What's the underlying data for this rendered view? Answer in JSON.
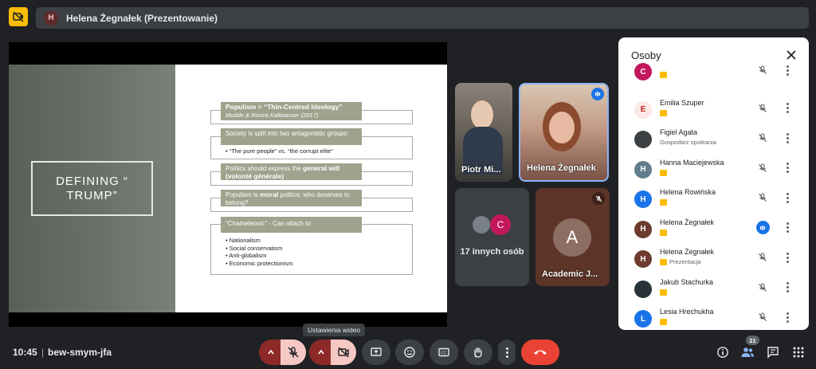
{
  "top_bar": {
    "avatar_letter": "H",
    "title": "Helena Żegnałek (Prezentowanie)"
  },
  "slide": {
    "title": "DEFINING “\nTRUMP”",
    "boxes": [
      {
        "heading": "Populism = “Thin-Centred Ideology”",
        "sub": "Mudde & Rovira Kaltwasser (2017)"
      },
      {
        "heading": "Society is split into two antagonistic groups:",
        "bullet": "• “The pure people” vs. “the corrupt elite”"
      },
      {
        "heading_pre": "Politics should express the ",
        "heading_bold": "general will (volonté générale)"
      },
      {
        "heading_pre": "Populism is ",
        "heading_bold": "moral",
        "heading_post": " politics: who deserves to belong?"
      },
      {
        "heading": "“Chameleonic” - Can attach to:",
        "bullets": [
          "• Nationalism",
          "• Social conservatism",
          "• Anti-globalism",
          "• Economic protectionism"
        ]
      }
    ]
  },
  "tiles": {
    "piotr": "Piotr Mi...",
    "helena": "Helena Żegnałek",
    "others_letter": "C",
    "others_label": "17 innych osób",
    "academic_letter": "A",
    "academic_name": "Academic J..."
  },
  "panel": {
    "title": "Osoby",
    "people": [
      {
        "name": "",
        "letter": "C",
        "color": "#c2185b",
        "sub": "",
        "mic": "muted"
      },
      {
        "name": "Emilia Szuper",
        "letter": "E",
        "color": "#fce8e6",
        "sub": "",
        "mic": "muted"
      },
      {
        "name": "Figiel Agata",
        "letter": "",
        "color": "#3c4043",
        "sub": "Gospodarz spotkania",
        "mic": "muted"
      },
      {
        "name": "Hanna Maciejewska",
        "letter": "H",
        "color": "#607d8b",
        "sub": "",
        "mic": "muted"
      },
      {
        "name": "Helena Rowińska",
        "letter": "H",
        "color": "#1a73e8",
        "sub": "",
        "mic": "muted"
      },
      {
        "name": "Helena Żegnałek",
        "letter": "H",
        "color": "#6d3b2f",
        "sub": "",
        "mic": "speaking"
      },
      {
        "name": "Helena Żegnałek",
        "letter": "H",
        "color": "#6d3b2f",
        "sub": "Prezentacja",
        "mic": "off"
      },
      {
        "name": "Jakub Stachurka",
        "letter": "",
        "color": "#263238",
        "sub": "",
        "mic": "muted"
      },
      {
        "name": "Lesia Hrechukha",
        "letter": "L",
        "color": "#1a73e8",
        "sub": "",
        "mic": "muted"
      }
    ]
  },
  "bottom": {
    "clock": "10:45",
    "separator": "|",
    "meeting_code": "bew-smym-jfa",
    "tooltip": "Ustawienia wideo",
    "people_count": "21"
  },
  "colors": {
    "accent_blue": "#8ab4f8",
    "end_call": "#ea4335",
    "muted_bg": "#f6c8c5",
    "badge_yellow": "#fbbc04"
  }
}
